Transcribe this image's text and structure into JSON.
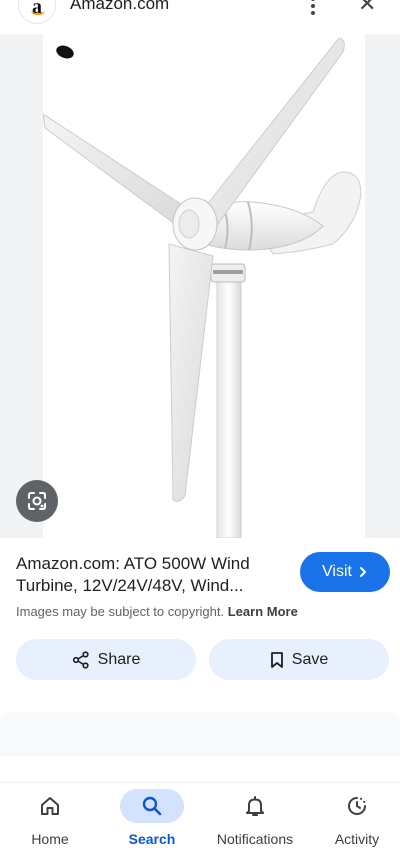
{
  "header": {
    "site_name": "Amazon.com",
    "logo_letter": "a"
  },
  "result": {
    "title": "Amazon.com: ATO 500W Wind Turbine, 12V/24V/48V, Wind...",
    "visit_label": "Visit",
    "copyright_text": "Images may be subject to copyright.",
    "learn_more_label": "Learn More"
  },
  "actions": {
    "share_label": "Share",
    "save_label": "Save"
  },
  "bottom_nav": {
    "items": [
      {
        "label": "Home",
        "icon": "home-icon",
        "active": false
      },
      {
        "label": "Search",
        "icon": "search-icon",
        "active": true
      },
      {
        "label": "Notifications",
        "icon": "bell-icon",
        "active": false
      },
      {
        "label": "Activity",
        "icon": "activity-icon",
        "active": false
      }
    ]
  },
  "colors": {
    "accent": "#1a73e8",
    "chip_bg": "#e8f0fe",
    "active_nav": "#0b57d0"
  }
}
